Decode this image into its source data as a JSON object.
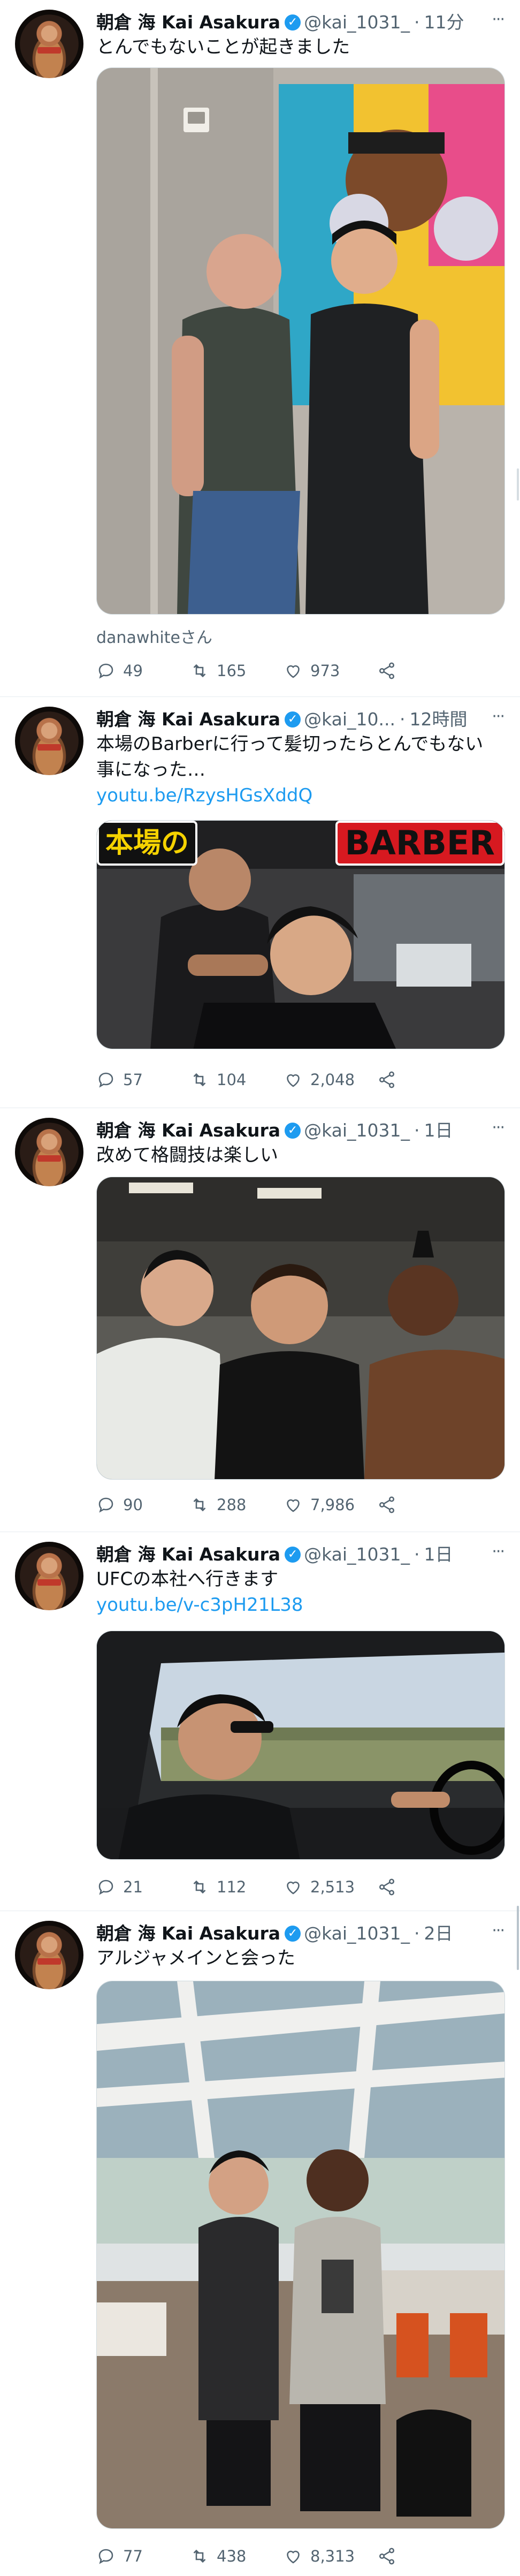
{
  "tweets": [
    {
      "name": "朝倉 海 Kai Asakura",
      "handle": "@kai_1031_",
      "dot": "·",
      "time": "11分",
      "text": "とんでもないことが起きました",
      "caption": "danawhiteさん",
      "replies": "49",
      "retweets": "165",
      "likes": "973"
    },
    {
      "name": "朝倉 海 Kai Asakura",
      "handle": "@kai_10...",
      "dot": "·",
      "time": "12時間",
      "text": "本場のBarberに行って髪切ったらとんでもない事になった…",
      "link": "youtu.be/RzysHGsXddQ",
      "thumb_left": "本場の",
      "thumb_right": "BARBER",
      "replies": "57",
      "retweets": "104",
      "likes": "2,048"
    },
    {
      "name": "朝倉 海 Kai Asakura",
      "handle": "@kai_1031_",
      "dot": "·",
      "time": "1日",
      "text": "改めて格闘技は楽しい",
      "replies": "90",
      "retweets": "288",
      "likes": "7,986"
    },
    {
      "name": "朝倉 海 Kai Asakura",
      "handle": "@kai_1031_",
      "dot": "·",
      "time": "1日",
      "text": "UFCの本社へ行きます",
      "link": "youtu.be/v-c3pH21L38",
      "replies": "21",
      "retweets": "112",
      "likes": "2,513"
    },
    {
      "name": "朝倉 海 Kai Asakura",
      "handle": "@kai_1031_",
      "dot": "·",
      "time": "2日",
      "text": "アルジャメインと会った",
      "replies": "77",
      "retweets": "438",
      "likes": "8,313"
    }
  ],
  "icons": {
    "verified": "✓",
    "more": "···"
  },
  "colors": {
    "accent": "#1d9bf0",
    "muted": "#536471",
    "border": "#e6ecf0"
  }
}
